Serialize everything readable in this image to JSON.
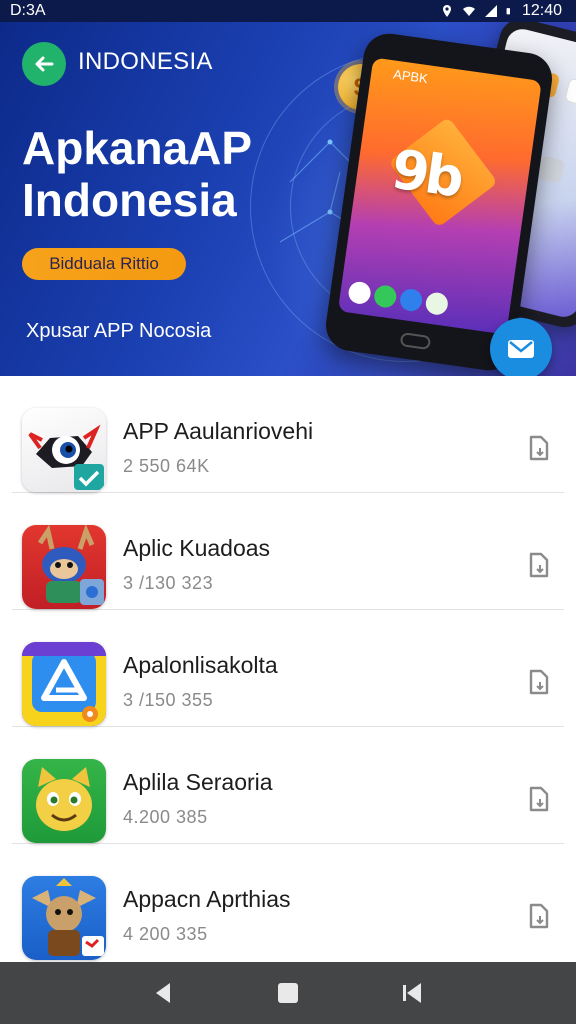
{
  "status_bar": {
    "time_left": "D:3A",
    "time_right": "12:40",
    "icons": [
      "location-icon",
      "wifi-icon",
      "signal-icon",
      "battery-icon"
    ]
  },
  "header": {
    "country": "INDONESIA",
    "title_line1": "ApkanaAP",
    "title_line2": "Indonesia",
    "pill_label": "Bidduala Rittio",
    "subtitle": "Xpusar APP Nocosia",
    "phone_brand": "APBK",
    "coin_symbol": "$",
    "phone_logo": "9b",
    "accent": "#21b36b"
  },
  "apps": [
    {
      "name": "APP Aaulanriovehi",
      "meta": "2 550 64K",
      "icon": "eye-bot-icon"
    },
    {
      "name": "Aplic Kuadoas",
      "meta": "3 /130 323",
      "icon": "warrior-icon"
    },
    {
      "name": "Apalonlisakolta",
      "meta": "3 /150 355",
      "icon": "triangle-a-icon"
    },
    {
      "name": "Aplila Seraoria",
      "meta": "4.200 385",
      "icon": "cat-face-icon"
    },
    {
      "name": "Appacn Aprthias",
      "meta": "4 200 335",
      "icon": "fox-warrior-icon"
    }
  ],
  "nav": {
    "back": "back-icon",
    "home": "home-icon",
    "recents": "recents-icon"
  }
}
